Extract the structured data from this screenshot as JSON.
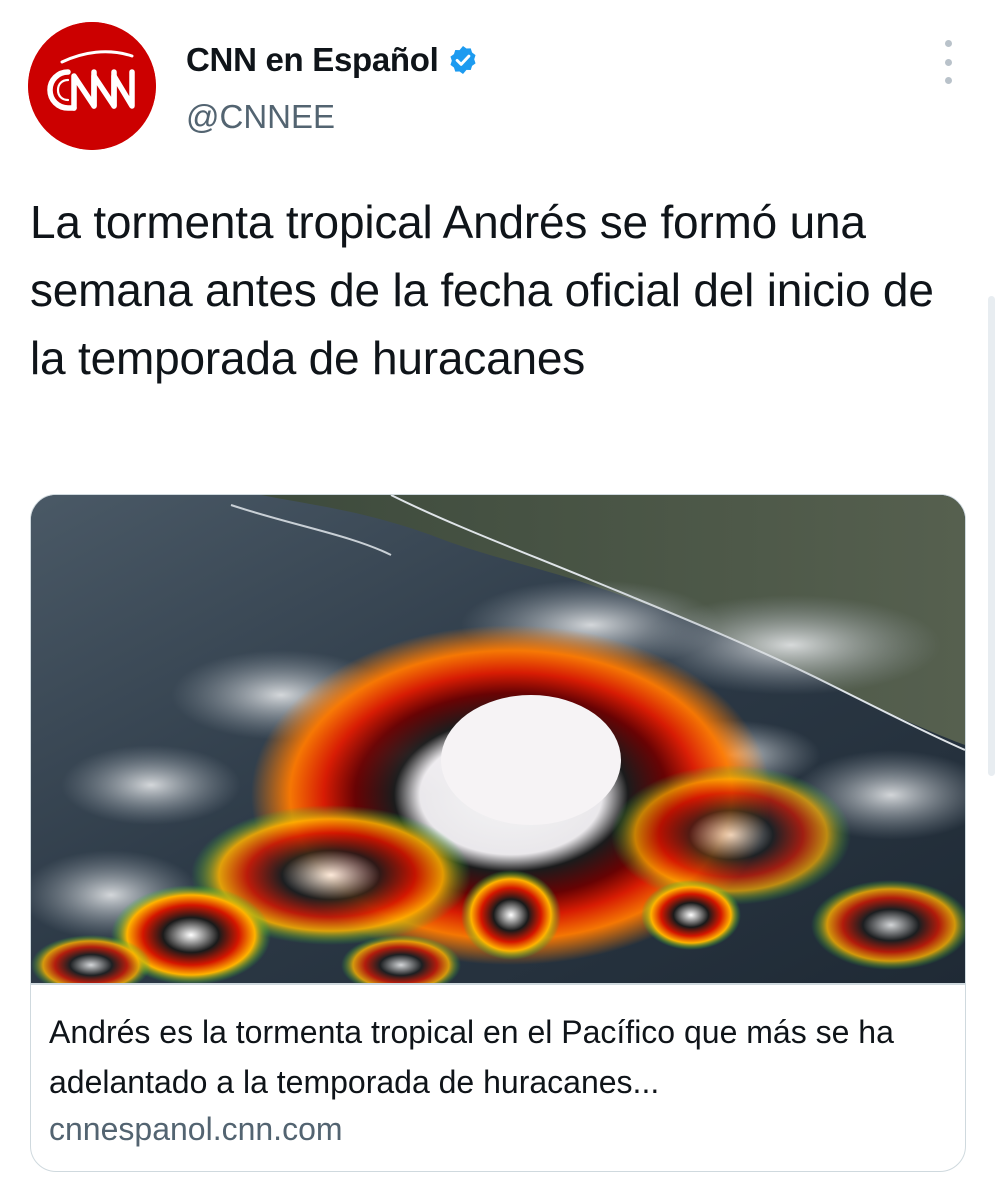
{
  "author": {
    "name": "CNN en Español",
    "handle": "@CNNEE",
    "verified": true,
    "avatar_text": "CNN",
    "avatar_color": "#cc0000"
  },
  "tweet": {
    "text": "La tormenta tropical Andrés se formó una semana antes de la fecha oficial del inicio de la temporada de huracanes"
  },
  "link_card": {
    "image_alt": "satellite-storm-image",
    "title": "Andrés es la tormenta tropical en el Pacífico que más se ha adelantado a la temporada de huracanes...",
    "domain": "cnnespanol.cnn.com"
  },
  "icons": {
    "verified": "verified-badge-icon",
    "more": "more-options-icon"
  },
  "colors": {
    "verified_blue": "#1d9bf0",
    "secondary_text": "#536471",
    "border": "#cfd9de"
  }
}
